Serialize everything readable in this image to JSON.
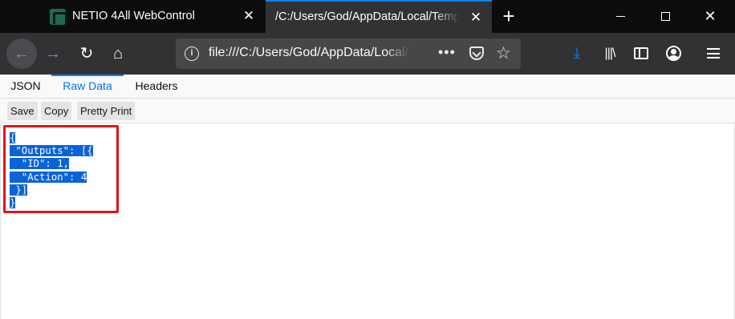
{
  "tabs": [
    {
      "title": "NETIO 4All WebControl",
      "active": false
    },
    {
      "title": "/C:/Users/God/AppData/Local/Temp/netio.json",
      "active": true
    }
  ],
  "window_controls": {
    "minimize": "minimize",
    "maximize": "maximize",
    "close": "close"
  },
  "navbar": {
    "url": "file:///C:/Users/God/AppData/Local/Temp/netio.json",
    "more_label": "•••"
  },
  "viewer": {
    "tabs": [
      "JSON",
      "Raw Data",
      "Headers"
    ],
    "active_tab": "Raw Data",
    "toolbar": {
      "save_label": "Save",
      "copy_label": "Copy",
      "pretty_print_label": "Pretty Print"
    },
    "raw_lines": [
      "{",
      " \"Outputs\": [{",
      "  \"ID\": 1,",
      "  \"Action\": 4",
      " }]",
      "}"
    ]
  },
  "colors": {
    "tabstrip": "#0c0c0d",
    "toolbar": "#323234",
    "accent": "#0a84ff",
    "selection": "#0a63d8",
    "highlight_border": "#e3131b"
  },
  "icons": {
    "favicon": "netio-favicon",
    "back": "back-arrow-icon",
    "forward": "forward-arrow-icon",
    "reload": "reload-icon",
    "home": "home-icon",
    "info": "info-icon",
    "pocket": "pocket-icon",
    "star": "bookmark-star-icon",
    "download": "download-icon",
    "library": "library-icon",
    "sidebar": "sidebar-icon",
    "account": "account-icon",
    "menu": "hamburger-menu-icon"
  }
}
